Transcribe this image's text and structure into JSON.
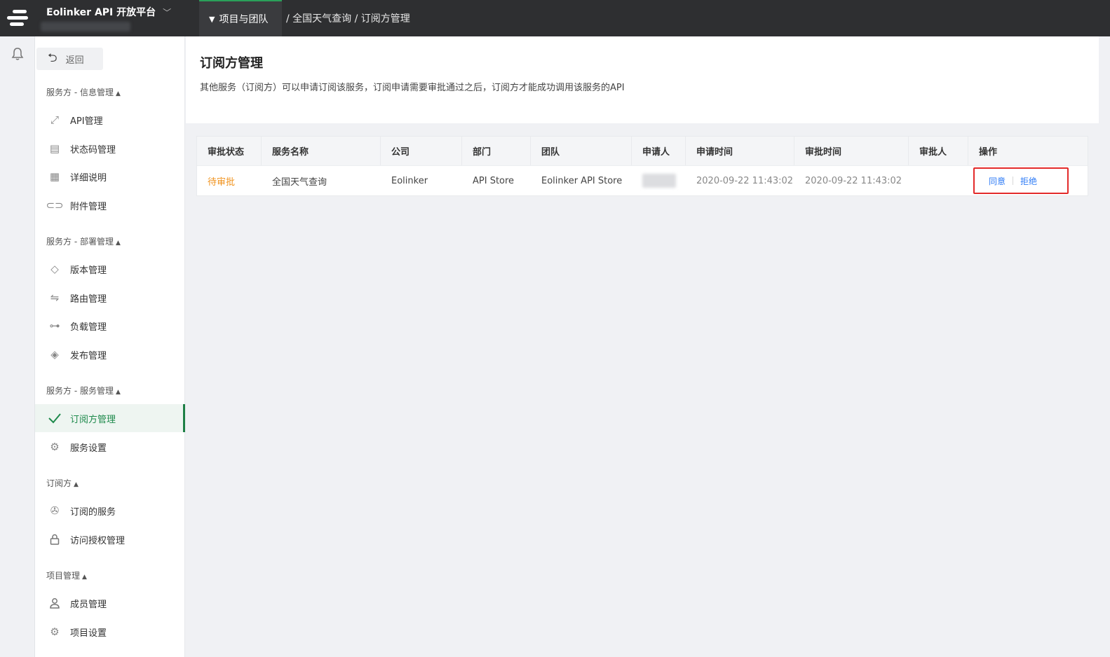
{
  "topbar": {
    "brand": "Eolinker API 开放平台",
    "crumb_tab": "项目与团队",
    "crumb_path": "/ 全国天气查询 / 订阅方管理"
  },
  "sidebar": {
    "back_label": "返回",
    "sections": [
      {
        "title": "服务方 - 信息管理",
        "items": [
          "API管理",
          "状态码管理",
          "详细说明",
          "附件管理"
        ]
      },
      {
        "title": "服务方 - 部署管理",
        "items": [
          "版本管理",
          "路由管理",
          "负载管理",
          "发布管理"
        ]
      },
      {
        "title": "服务方 - 服务管理",
        "items": [
          "订阅方管理",
          "服务设置"
        ]
      },
      {
        "title": "订阅方",
        "items": [
          "订阅的服务",
          "访问授权管理"
        ]
      },
      {
        "title": "项目管理",
        "items": [
          "成员管理",
          "项目设置"
        ]
      }
    ],
    "active_item": "订阅方管理"
  },
  "main": {
    "title": "订阅方管理",
    "description": "其他服务（订阅方）可以申请订阅该服务，订阅申请需要审批通过之后，订阅方才能成功调用该服务的API"
  },
  "table": {
    "columns": [
      "审批状态",
      "服务名称",
      "公司",
      "部门",
      "团队",
      "申请人",
      "申请时间",
      "审批时间",
      "审批人",
      "操作"
    ],
    "rows": [
      {
        "status": "待审批",
        "service": "全国天气查询",
        "company": "Eolinker",
        "department": "API Store",
        "team": "Eolinker API Store",
        "applicant": "",
        "apply_time": "2020-09-22 11:43:02",
        "approve_time": "2020-09-22 11:43:02",
        "approver": "",
        "actions": {
          "agree": "同意",
          "reject": "拒绝"
        }
      }
    ]
  },
  "colors": {
    "accent_green": "#1e8a4c",
    "pending_orange": "#f0921c",
    "link_blue": "#2f7cf6",
    "highlight_red": "#e32a2a",
    "topbar_bg": "#2e2f31"
  },
  "icons": [
    "menu-logo-icon",
    "chevron-down-icon",
    "bell-icon",
    "back-arrow-icon",
    "api-icon",
    "status-code-icon",
    "document-icon",
    "attachment-icon",
    "tag-icon",
    "route-icon",
    "load-balance-icon",
    "publish-icon",
    "check-icon",
    "settings-icon",
    "pin-icon",
    "lock-icon",
    "user-icon"
  ]
}
